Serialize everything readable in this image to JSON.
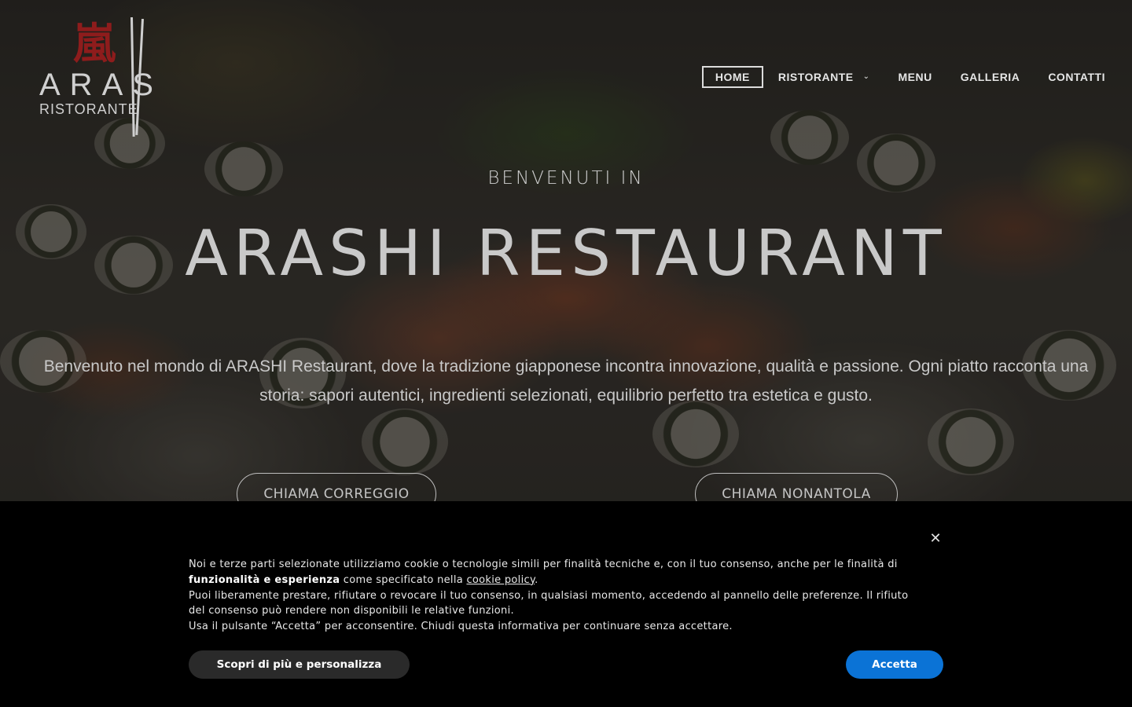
{
  "logo": {
    "kanji": "嵐",
    "name": "ARAS",
    "subtitle": "RISTORANTE"
  },
  "nav": {
    "items": [
      {
        "label": "HOME",
        "active": true
      },
      {
        "label": "RISTORANTE",
        "dropdown": true
      },
      {
        "label": "MENU"
      },
      {
        "label": "GALLERIA"
      },
      {
        "label": "CONTATTI"
      }
    ],
    "chevron_icon": "chevron-down-icon"
  },
  "hero": {
    "kicker": "BENVENUTI IN",
    "title": "ARASHI RESTAURANT",
    "text": "Benvenuto nel mondo di ARASHI Restaurant, dove la tradizione giapponese incontra innovazione, qualità e passione. Ogni piatto racconta una storia: sapori autentici, ingredienti selezionati, equilibrio perfetto tra estetica e gusto.",
    "buttons": {
      "call_correggio": "CHIAMA CORREGGIO",
      "call_nonantola": "CHIAMA NONANTOLA"
    }
  },
  "cookie": {
    "close_icon": "close-icon",
    "text_1": "Noi e terze parti selezionate utilizziamo cookie o tecnologie simili per finalità tecniche e, con il tuo consenso, anche per le finalità di",
    "text_bold": "funzionalità e esperienza",
    "text_2": " come specificato nella ",
    "link": "cookie policy",
    "text_3": ".",
    "text_4": "Puoi liberamente prestare, rifiutare o revocare il tuo consenso, in qualsiasi momento, accedendo al pannello delle preferenze. Il rifiuto del consenso può rendere non disponibili le relative funzioni.",
    "text_5": "Usa il pulsante “Accetta” per acconsentire. Chiudi questa informativa per continuare senza accettare.",
    "more_button": "Scopri di più e personalizza",
    "accept_button": "Accetta",
    "colors": {
      "accept": "#0b73d6",
      "background": "#000000"
    }
  }
}
